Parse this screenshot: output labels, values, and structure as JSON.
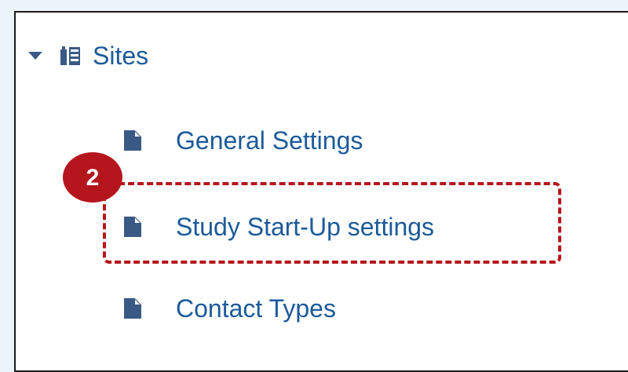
{
  "tree": {
    "root": {
      "label": "Sites",
      "expanded": true,
      "icon": "folder-sites-icon"
    },
    "children": [
      {
        "label": "General Settings",
        "icon": "document-icon"
      },
      {
        "label": "Study Start-Up settings",
        "icon": "document-icon",
        "highlighted": true
      },
      {
        "label": "Contact Types",
        "icon": "document-icon"
      }
    ]
  },
  "annotation": {
    "step_number": "2",
    "color": "#b5161d"
  },
  "colors": {
    "link": "#1c5a99",
    "icon": "#3a5a85",
    "background": "#eaf4fa"
  }
}
